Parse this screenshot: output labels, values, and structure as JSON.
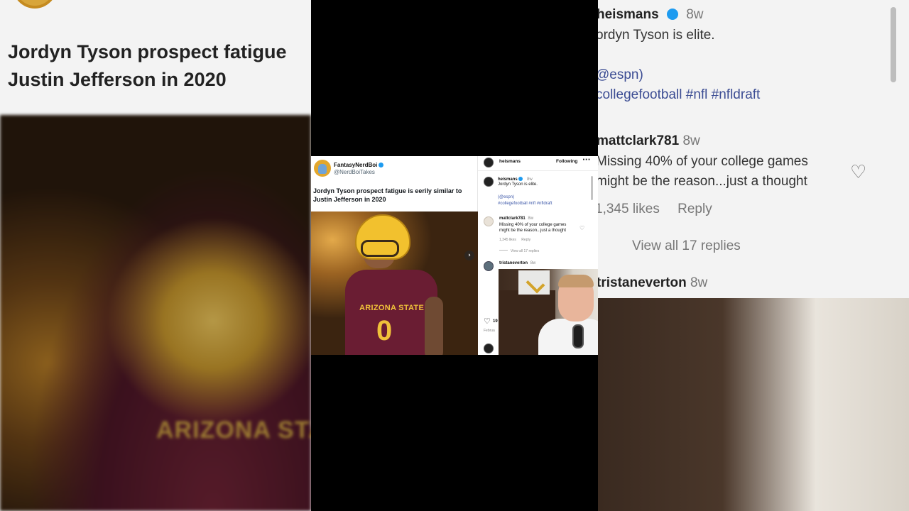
{
  "tweet": {
    "display_name": "FantasyNerdBoi",
    "handle": "@NerdBoiTakes",
    "text": "Jordyn Tyson prospect fatigue is eerily similar to Justin Jefferson in 2020",
    "photo_jersey_text": "ARIZONA STATE",
    "photo_jersey_number": "0",
    "next_glyph": "›"
  },
  "instagram": {
    "header": {
      "username": "heismans",
      "follow_label": "Following",
      "more_glyph": "···"
    },
    "caption": {
      "username": "heismans",
      "age": "8w",
      "text": "Jordyn Tyson is elite.",
      "mention": "(@espn)",
      "hashtags": "#collegefootball #nfl #nfldraft"
    },
    "comments": [
      {
        "username": "mattclark781",
        "age": "8w",
        "text_line1": "Missing 40% of your college games",
        "text_line2": "might be the reason...just a thought",
        "likes": "1,345 likes",
        "reply_label": "Reply",
        "view_replies": "View all 17 replies"
      },
      {
        "username": "tristaneverton",
        "age": "8w"
      }
    ],
    "like_count_partial": "19",
    "date_partial": "Februa"
  },
  "backdrop": {
    "left_title_line1": "Jordyn Tyson prospect fatigue",
    "left_title_line2": "Justin Jefferson in 2020",
    "left_jersey_text": "ARIZONA STAT",
    "right_username": "heismans",
    "right_age": "8w",
    "right_caption": "ordyn Tyson is elite.",
    "right_mention": "@espn)",
    "right_hashtags_a": "collegefootball",
    "right_hashtags_b": "#nfl #nfldraft",
    "right_comment_user": "mattclark781",
    "right_comment_age": "8w",
    "right_comment_line1": "Missing 40% of your college games",
    "right_comment_line2": "might be the reason...just a thought",
    "right_likes": "1,345 likes",
    "right_reply": "Reply",
    "right_view_replies": "View all 17 replies",
    "right_comment2_user": "tristaneverton",
    "right_comment2_age": "8w"
  },
  "icons": {
    "verified": "verified-badge-icon",
    "heart": "heart-icon",
    "chevron": "chevron-right-icon"
  },
  "colors": {
    "verified_blue": "#1d9bf0",
    "link_blue": "#3c57a8",
    "asu_maroon": "#6a1d33",
    "asu_gold": "#f0c23a"
  }
}
